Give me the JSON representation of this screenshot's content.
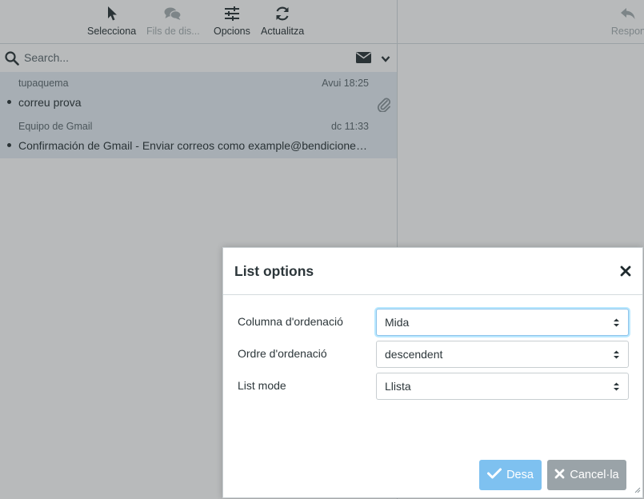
{
  "toolbar": {
    "select_label": "Selecciona",
    "threads_label": "Fils de dis...",
    "options_label": "Opcions",
    "refresh_label": "Actualitza",
    "reply_label": "Respon"
  },
  "search": {
    "placeholder": "Search..."
  },
  "messages": [
    {
      "from": "tupaquema",
      "date": "Avui 18:25",
      "subject": "correu prova",
      "attachment": true
    },
    {
      "from": "Equipo de Gmail",
      "date": "dc 11:33",
      "subject": "Confirmación de Gmail - Enviar correos como example@bendicionesmujer.com",
      "attachment": false
    }
  ],
  "dialog": {
    "title": "List options",
    "fields": [
      {
        "label": "Columna d'ordenació",
        "value": "Mida"
      },
      {
        "label": "Ordre d'ordenació",
        "value": "descendent"
      },
      {
        "label": "List mode",
        "value": "Llista"
      }
    ],
    "save_label": "Desa",
    "cancel_label": "Cancel·la"
  },
  "colors": {
    "selected_row": "#e6eef5",
    "save_button": "#7ec1f0",
    "cancel_button": "#9aa3a8",
    "focus_ring": "#8fc3ea"
  }
}
